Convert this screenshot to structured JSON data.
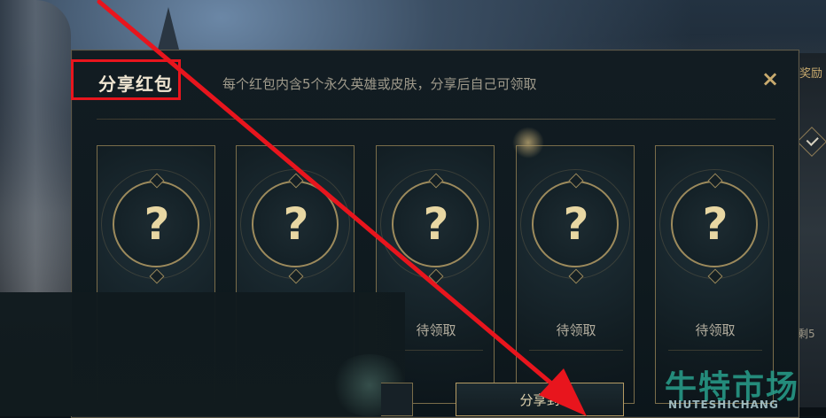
{
  "dialog": {
    "title": "分享红包",
    "subtitle": "每个红包内含5个永久英雄或皮肤，分享后自己可领取",
    "close_icon": "×"
  },
  "cards": [
    {
      "symbol": "?",
      "status": ""
    },
    {
      "symbol": "?",
      "status": ""
    },
    {
      "symbol": "?",
      "status": "待领取"
    },
    {
      "symbol": "?",
      "status": "待领取"
    },
    {
      "symbol": "?",
      "status": "待领取"
    }
  ],
  "buttons": {
    "share_label": "分享到"
  },
  "background": {
    "right_peek_text": "奖励",
    "right_peek_bottom": "剩5"
  },
  "watermark": {
    "main": "牛特市场",
    "sub": "NIUTESHICHANG"
  },
  "colors": {
    "accent_gold": "#c8aa6e",
    "annotation_red": "#e8151d",
    "watermark_teal": "#28a08c"
  }
}
